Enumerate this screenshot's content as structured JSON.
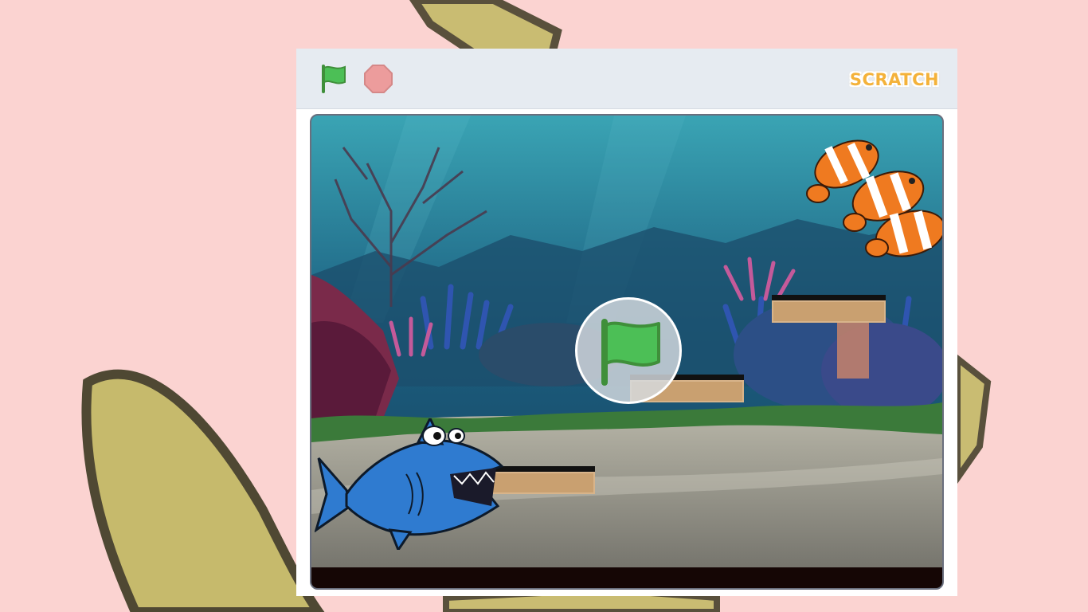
{
  "page": {
    "background_color": "#fbd3d1"
  },
  "controls": {
    "green_flag": {
      "icon": "green-flag-icon",
      "color": "#4cbf56"
    },
    "stop": {
      "icon": "stop-sign-icon",
      "color": "#ec9c9c"
    },
    "logo_text": "SCRATCH"
  },
  "stage": {
    "scene": "underwater",
    "sprites": [
      "shark",
      "clownfish-1",
      "clownfish-2",
      "clownfish-3",
      "platform-1",
      "platform-2",
      "platform-3"
    ],
    "start_overlay_icon": "green-flag-icon"
  }
}
